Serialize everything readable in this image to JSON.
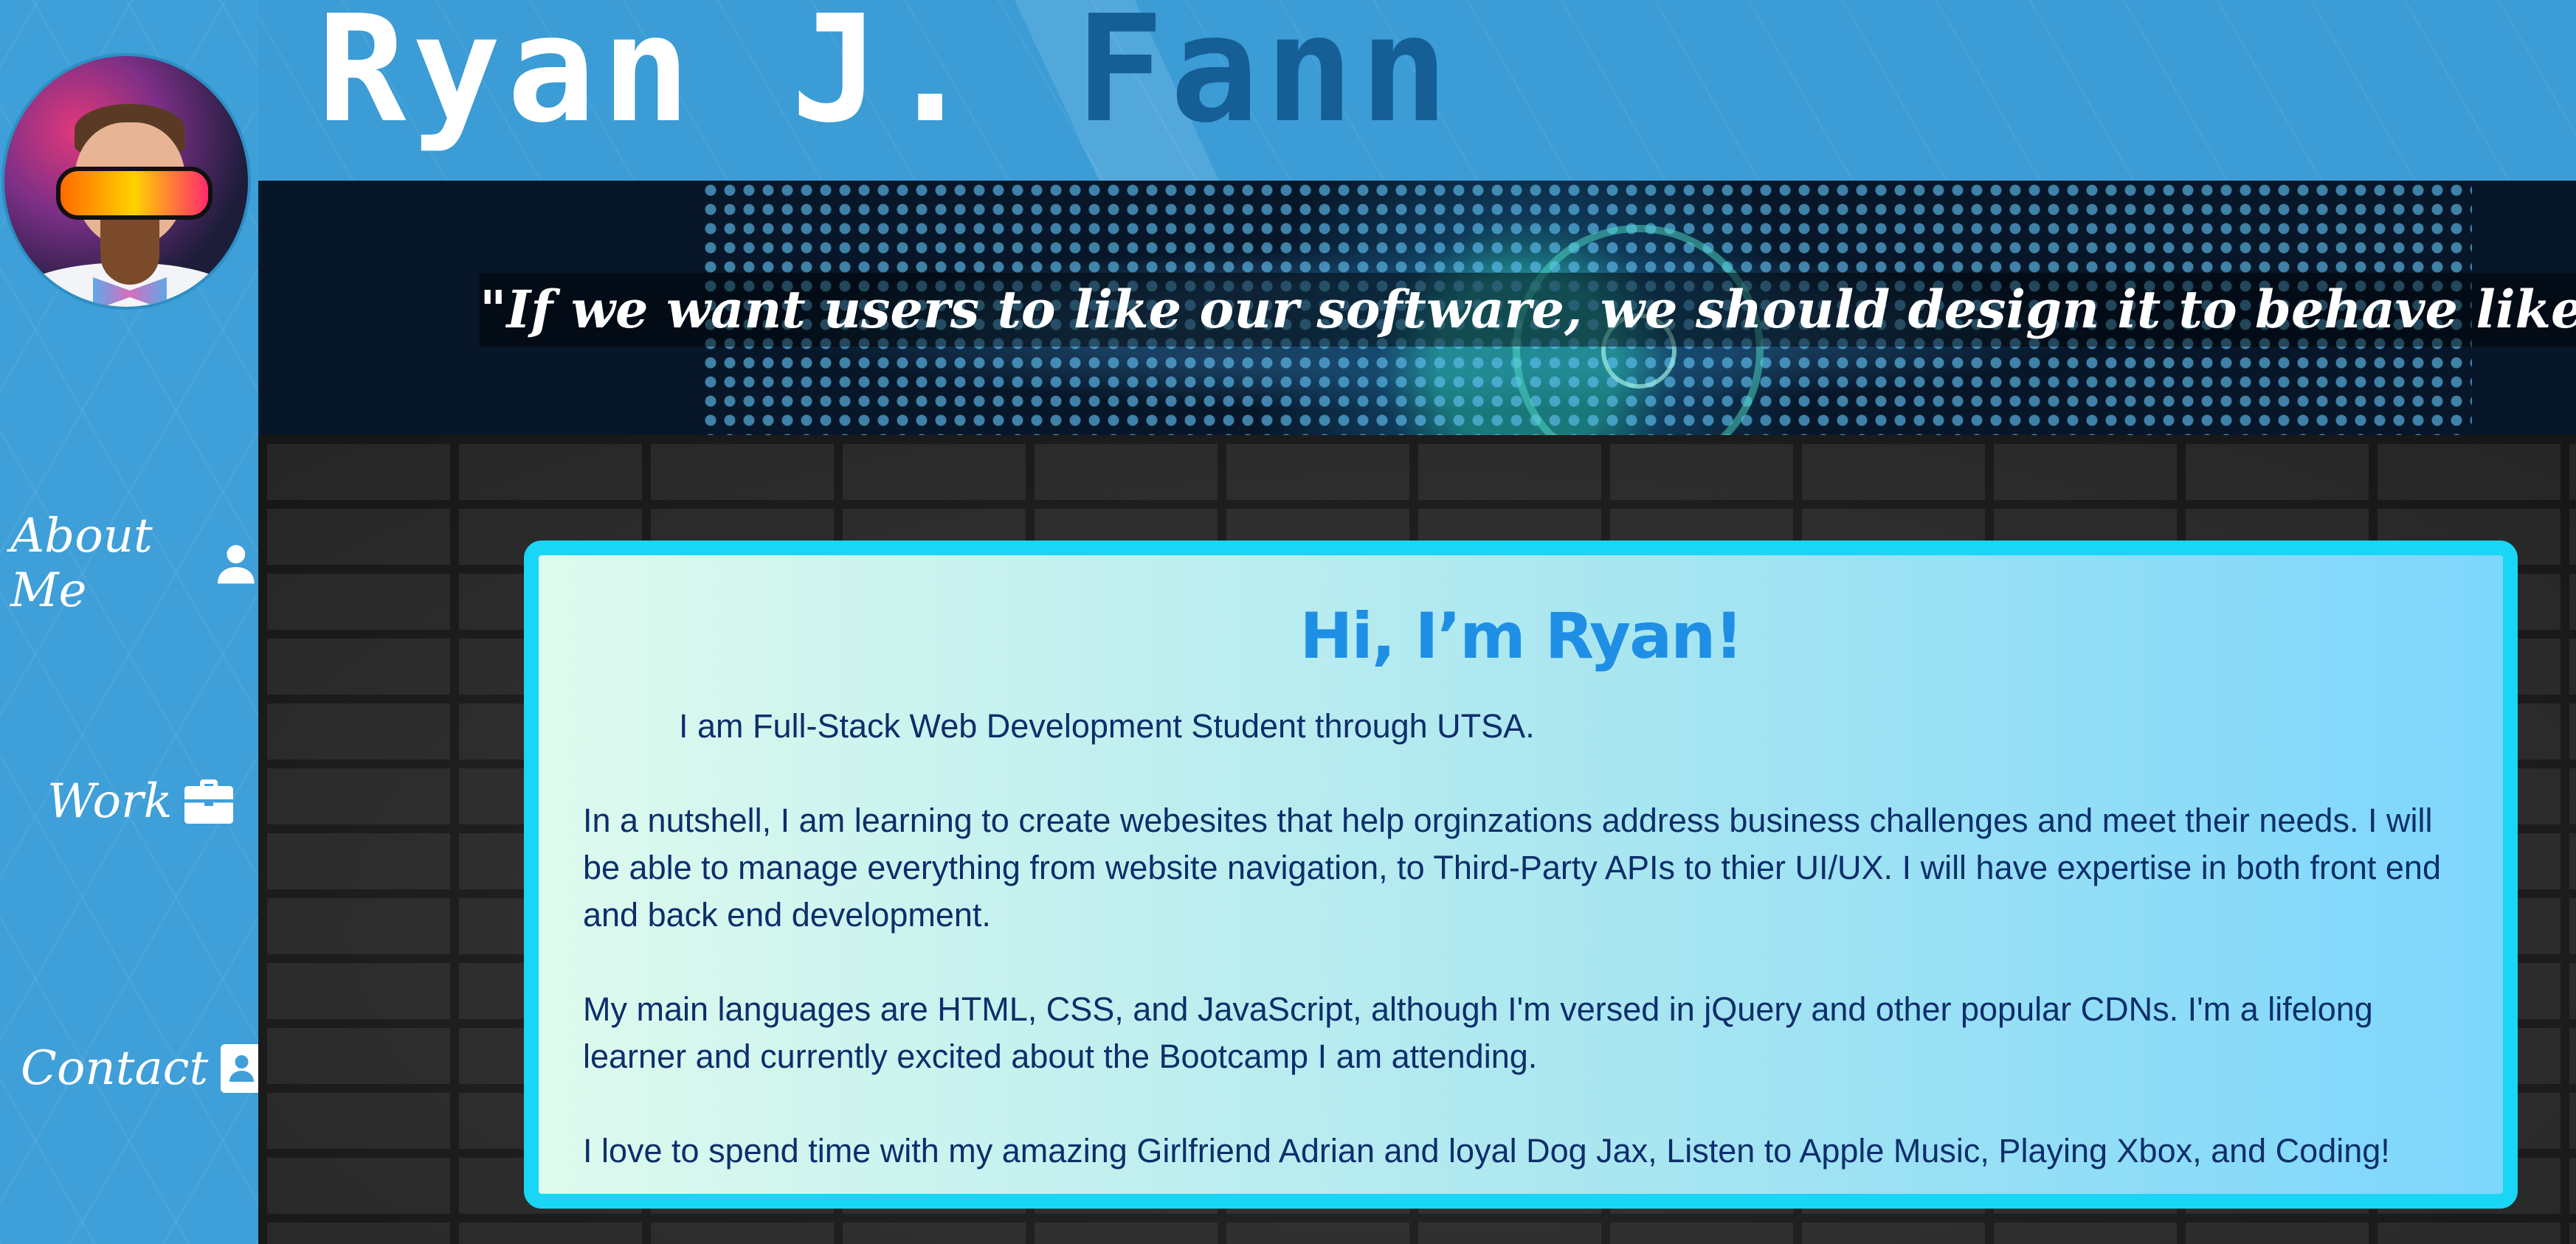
{
  "header": {
    "title_first": "Ryan J.",
    "title_last": "Fann",
    "quote": "\"If we want users to like our software, we should design it to behave like a likeable person.\" — Alan"
  },
  "sidebar": {
    "items": [
      {
        "label": "About Me",
        "icon": "user-icon"
      },
      {
        "label": "Work",
        "icon": "briefcase-icon"
      },
      {
        "label": "Contact",
        "icon": "contact-card-icon"
      }
    ]
  },
  "about": {
    "heading": "Hi, I’m Ryan!",
    "paragraphs": [
      "I am Full-Stack Web Development Student through UTSA.",
      "In a nutshell, I am learning to create webesites that help orginzations address business challenges and meet their needs. I will be able to manage everything from website navigation, to Third-Party APIs to thier UI/UX. I will have expertise in both front end and back end development.",
      "My main languages are HTML, CSS, and JavaScript, although I'm versed in jQuery and other popular CDNs. I'm a lifelong learner and currently excited about the Bootcamp I am attending.",
      "I love to spend time with my amazing Girlfriend Adrian and loyal Dog Jax, Listen to Apple Music, Playing Xbox, and Coding!"
    ]
  },
  "colors": {
    "sidebar_bg": "#3f9fd8",
    "title_accent": "#155e96",
    "card_border": "#19d6f6",
    "heading": "#1e8fe5",
    "body_text": "#0d2e6b"
  }
}
